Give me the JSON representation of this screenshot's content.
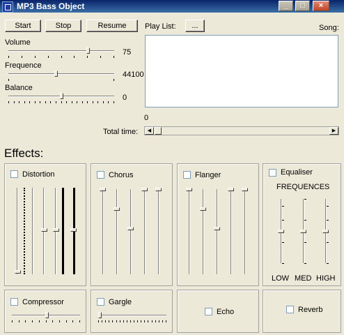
{
  "window": {
    "title": "MP3 Bass Object",
    "controls": {
      "minimize": "_",
      "maximize": "□",
      "close": "×"
    }
  },
  "transport": {
    "start_label": "Start",
    "stop_label": "Stop",
    "resume_label": "Resume"
  },
  "playlist": {
    "label": "Play List:",
    "browse_label": "...",
    "song_label": "Song:"
  },
  "sliders": {
    "volume": {
      "label": "Volume",
      "value": "75",
      "level": 0.75
    },
    "frequence": {
      "label": "Frequence",
      "value": "44100",
      "level": 0.45
    },
    "balance": {
      "label": "Balance",
      "value": "0",
      "level": 0.5
    }
  },
  "time": {
    "position": "0",
    "total_label": "Total time:"
  },
  "effects": {
    "heading": "Effects:",
    "distortion": {
      "label": "Distortion"
    },
    "chorus": {
      "label": "Chorus"
    },
    "flanger": {
      "label": "Flanger"
    },
    "equaliser": {
      "label": "Equaliser",
      "frequences_label": "FREQUENCES",
      "bands": [
        "LOW",
        "MED",
        "HIGH"
      ]
    },
    "compressor": {
      "label": "Compressor"
    },
    "gargle": {
      "label": "Gargle"
    },
    "echo": {
      "label": "Echo"
    },
    "reverb": {
      "label": "Reverb"
    }
  }
}
